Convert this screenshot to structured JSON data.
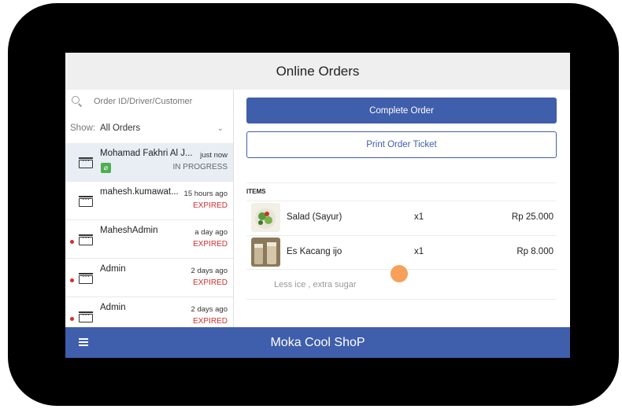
{
  "header": {
    "title": "Online Orders"
  },
  "search": {
    "placeholder": "Order ID/Driver/Customer"
  },
  "filter": {
    "label": "Show:",
    "value": "All Orders"
  },
  "orders": [
    {
      "name": "Mohamad Fakhri Al J...",
      "time": "just now",
      "status": "IN PROGRESS",
      "badge": "gojek-icon",
      "unread": false,
      "selected": true
    },
    {
      "name": "mahesh.kumawat...",
      "time": "15 hours ago",
      "status": "EXPIRED",
      "unread": false,
      "selected": false
    },
    {
      "name": "MaheshAdmin",
      "time": "a day ago",
      "status": "EXPIRED",
      "unread": true,
      "selected": false
    },
    {
      "name": "Admin",
      "time": "2 days ago",
      "status": "EXPIRED",
      "unread": true,
      "selected": false
    },
    {
      "name": "Admin",
      "time": "2 days ago",
      "status": "EXPIRED",
      "unread": true,
      "selected": false
    }
  ],
  "detail": {
    "complete_label": "Complete Order",
    "print_label": "Print Order Ticket",
    "items_header": "ITEMS",
    "items": [
      {
        "name": "Salad (Sayur)",
        "qty": "x1",
        "price": "Rp 25.000"
      },
      {
        "name": "Es Kacang ijo",
        "qty": "x1",
        "price": "Rp 8.000"
      }
    ],
    "note": "Less ice , extra sugar"
  },
  "footer": {
    "store_name": "Moka Cool ShoP"
  },
  "colors": {
    "primary": "#3f5eac",
    "expired": "#d32f2f",
    "selected_row": "#e8eef4"
  }
}
